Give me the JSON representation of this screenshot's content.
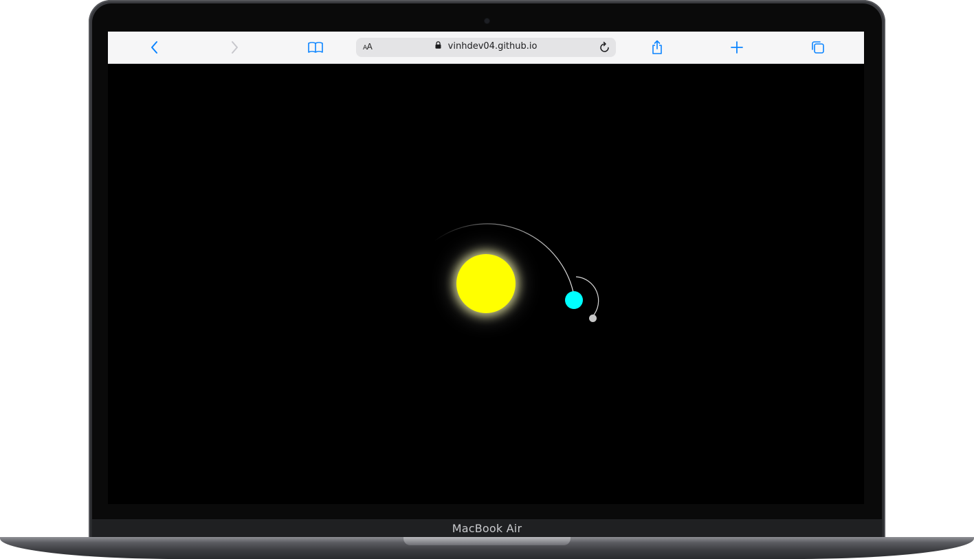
{
  "browser": {
    "back_label": "Back",
    "forward_label": "Forward",
    "address": {
      "text_size_label": "AA",
      "url": "vinhdev04.github.io"
    }
  },
  "icons": {
    "back": "chevron-left-icon",
    "forward": "chevron-right-icon",
    "bookmarks": "book-icon",
    "lock": "lock-icon",
    "reload": "reload-icon",
    "share": "share-icon",
    "new_tab": "plus-icon",
    "tabs": "tabs-icon"
  },
  "colors": {
    "accent": "#0a84ff",
    "disabled": "#c7c7cc",
    "screen_bg": "#000000",
    "sun": "#ffff00",
    "earth": "#00ffff",
    "moon": "#c7c7c7",
    "trail": "#cfcfcf"
  },
  "device": {
    "label": "MacBook Air"
  }
}
